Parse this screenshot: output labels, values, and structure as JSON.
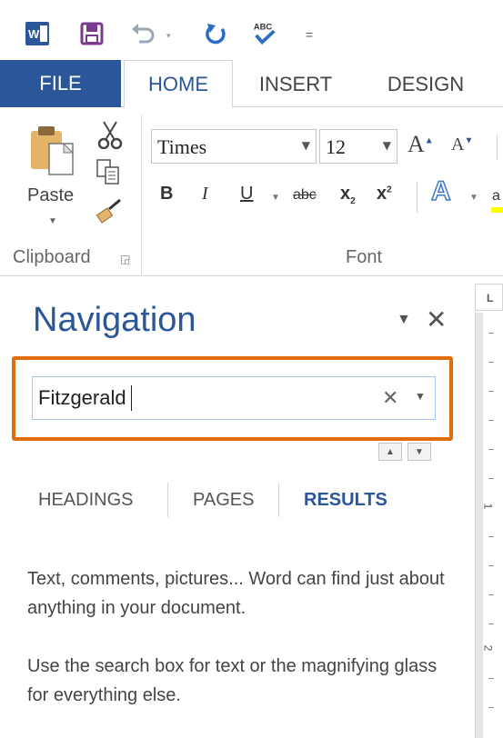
{
  "quick_access": {
    "icons": [
      "word-logo-icon",
      "save-icon",
      "undo-icon",
      "redo-icon",
      "spelling-icon",
      "customize-icon"
    ],
    "spelling_label": "ABC",
    "word_letter": "W",
    "customize_glyph": "="
  },
  "tabs": {
    "file": "FILE",
    "home": "HOME",
    "insert": "INSERT",
    "design": "DESIGN",
    "active": "HOME"
  },
  "ribbon": {
    "clipboard": {
      "paste_label": "Paste",
      "group_label": "Clipboard"
    },
    "font": {
      "font_name": "Times",
      "font_size": "12",
      "grow_label": "A",
      "shrink_label": "A",
      "bold": "B",
      "italic": "I",
      "underline": "U",
      "strikethrough": "abc",
      "subscript": "x",
      "subscript_mark": "2",
      "superscript": "x",
      "superscript_mark": "2",
      "text_effects": "A",
      "highlight_partial": "a",
      "group_label": "Font"
    }
  },
  "navigation": {
    "title": "Navigation",
    "search": {
      "value": "Fitzgerald"
    },
    "tabs": {
      "headings": "HEADINGS",
      "pages": "PAGES",
      "results": "RESULTS",
      "active": "RESULTS"
    },
    "help_text_1": "Text, comments, pictures... Word can find just about anything in your document.",
    "help_text_2": "Use the search box for text or the magnifying glass for everything else."
  },
  "ruler": {
    "corner": "L",
    "numbers": [
      "1",
      "2"
    ]
  },
  "colors": {
    "accent": "#2b579a",
    "highlight_border": "#e36c0a",
    "file_tab": "#2b579a"
  }
}
